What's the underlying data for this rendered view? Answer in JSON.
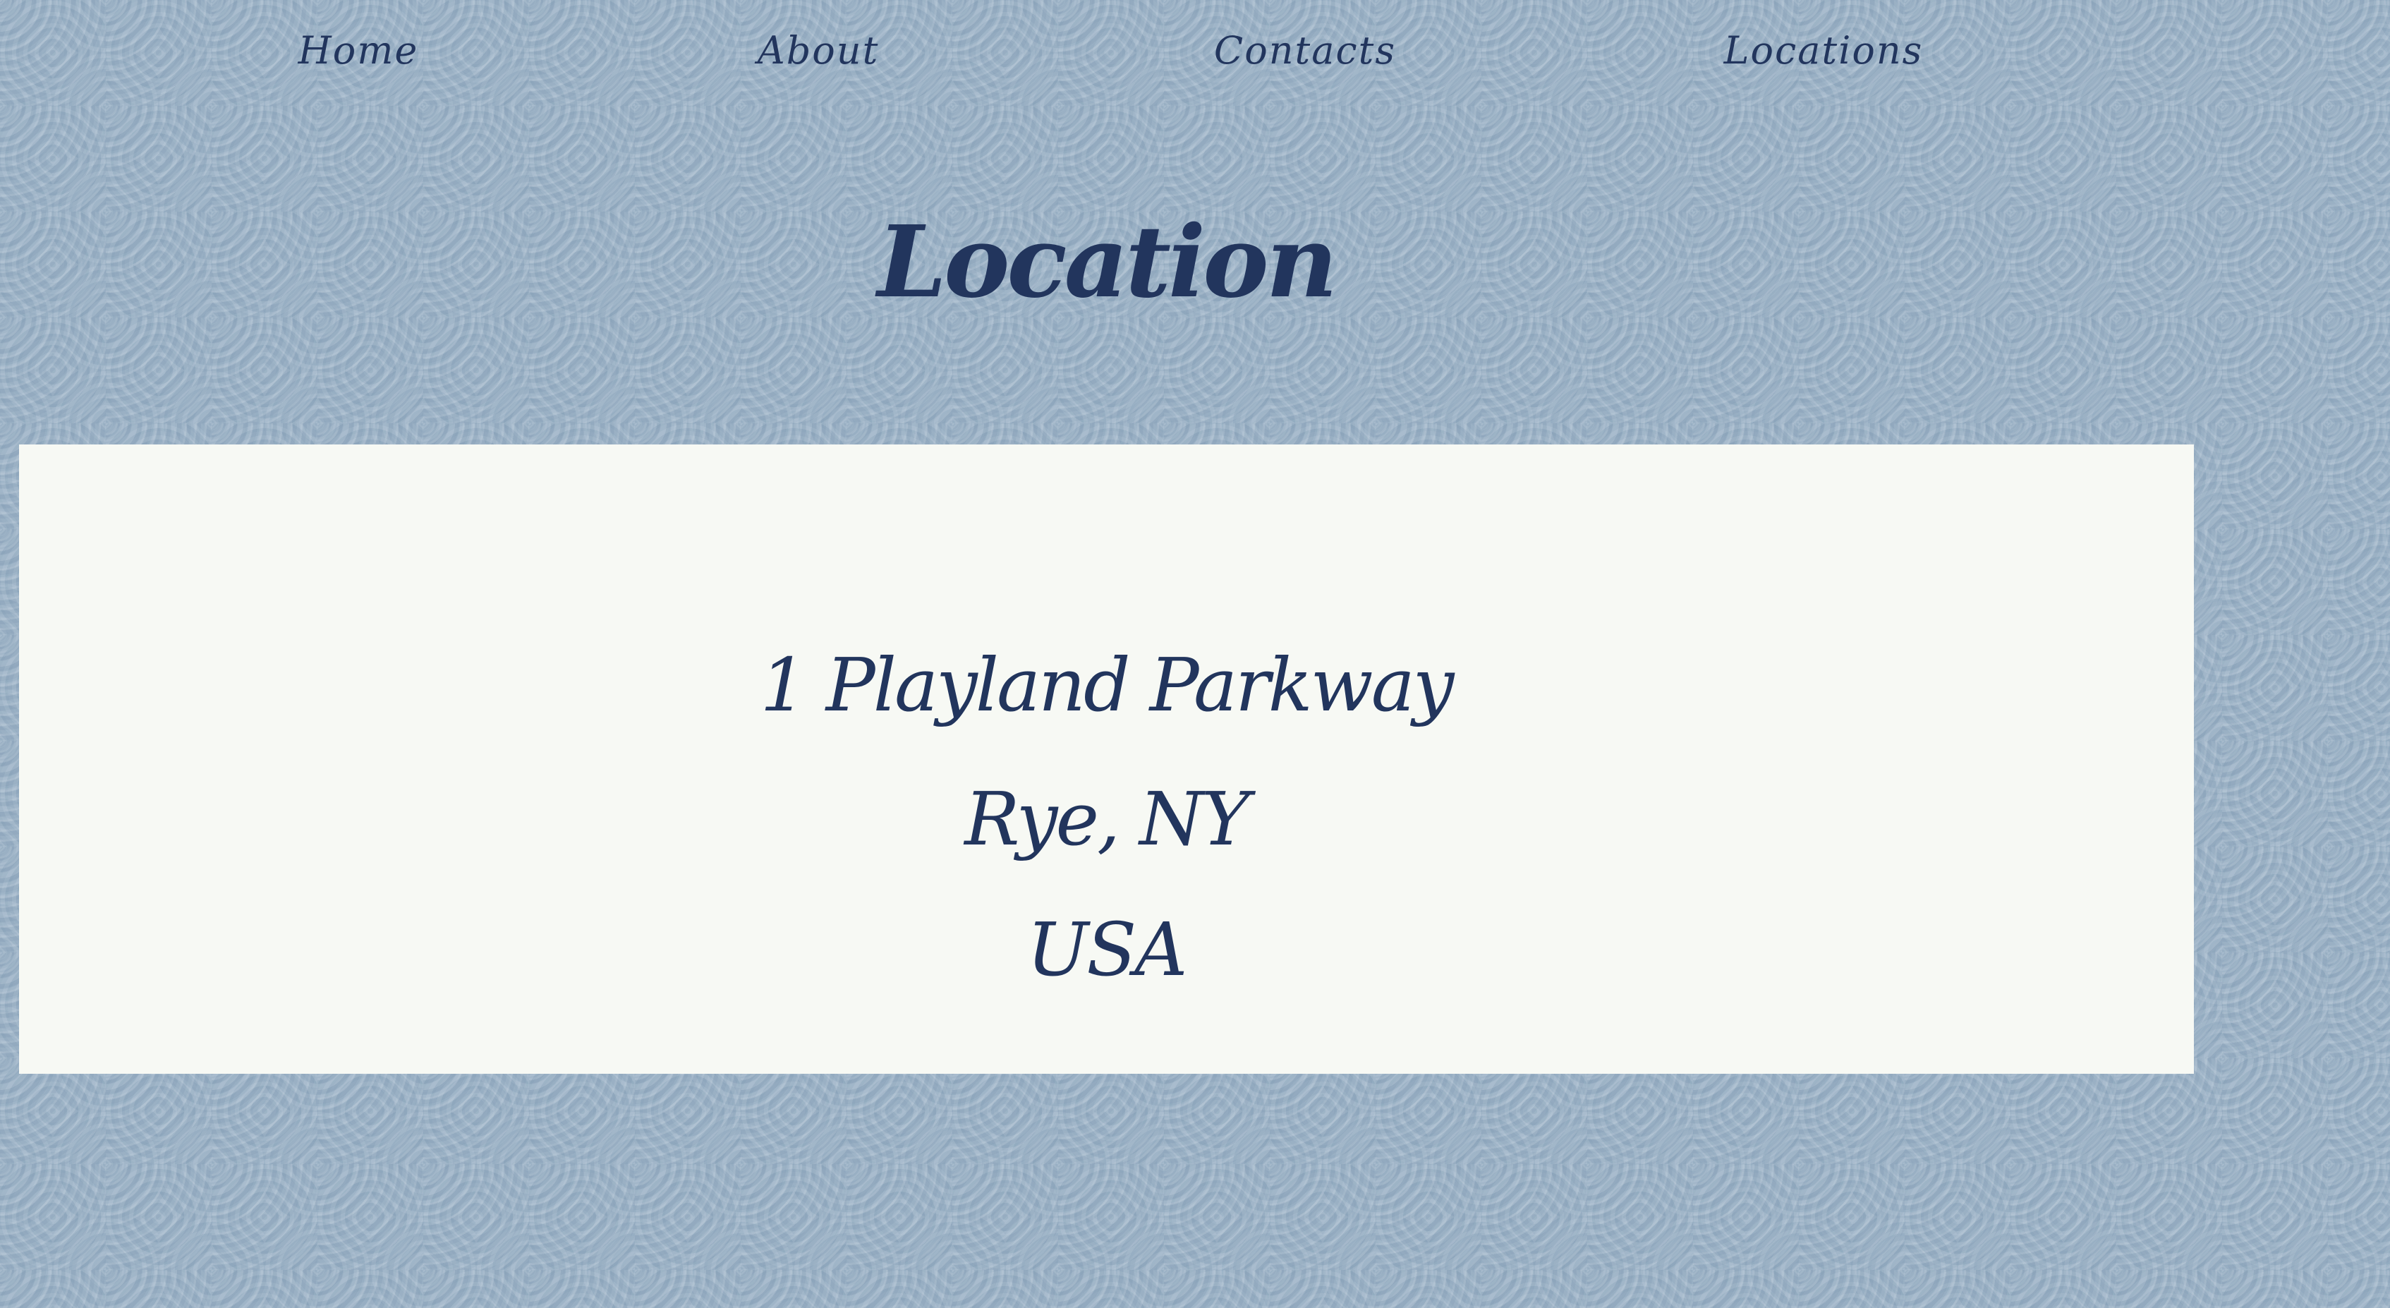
{
  "nav": {
    "items": [
      {
        "label": "Home"
      },
      {
        "label": "About"
      },
      {
        "label": "Contacts"
      },
      {
        "label": "Locations"
      }
    ]
  },
  "page": {
    "title": "Location"
  },
  "address": {
    "street": "1 Playland Parkway",
    "city_state": "Rye, NY",
    "country": "USA"
  },
  "colors": {
    "background": "#a3b7c9",
    "panel": "#f7f9f4",
    "text": "#22355d"
  }
}
